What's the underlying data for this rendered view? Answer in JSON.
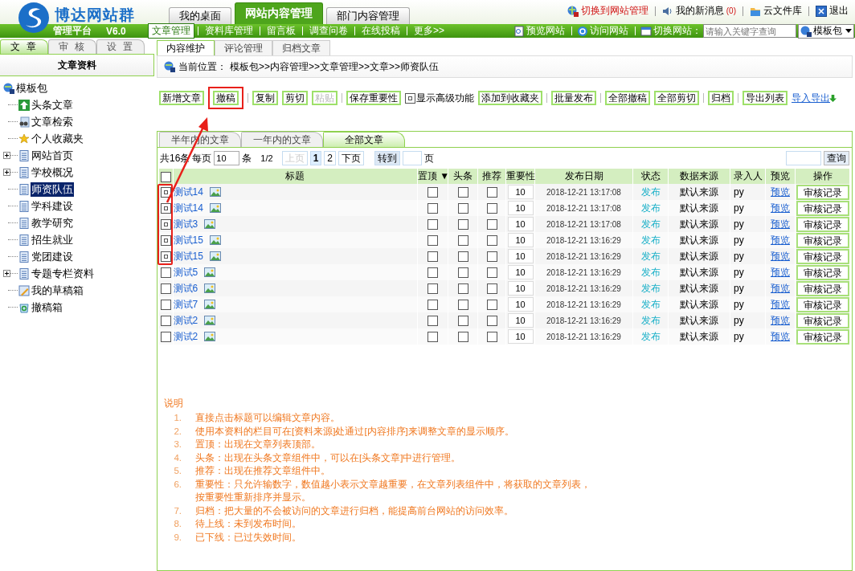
{
  "header": {
    "brand": "博达网站群",
    "subtitle": "管理平台",
    "version": "V6.0",
    "top_tabs": [
      {
        "label": "我的桌面",
        "selected": false
      },
      {
        "label": "网站内容管理",
        "selected": true
      },
      {
        "label": "部门内容管理",
        "selected": false
      }
    ],
    "top_links": [
      {
        "kind": "switch",
        "label": "切换到网站管理"
      },
      {
        "kind": "messages",
        "label": "我的新消息",
        "count": "(0)"
      },
      {
        "kind": "files",
        "label": "云文件库"
      },
      {
        "kind": "exit",
        "label": "退出"
      }
    ]
  },
  "nav": {
    "items": [
      {
        "label": "文章管理",
        "selected": true
      },
      {
        "label": "资料库管理",
        "selected": false
      },
      {
        "label": "留言板",
        "selected": false
      },
      {
        "label": "调查问卷",
        "selected": false
      },
      {
        "label": "在线投稿",
        "selected": false
      },
      {
        "label": "更多>>",
        "selected": false
      }
    ],
    "links": [
      {
        "kind": "preview",
        "label": "预览网站"
      },
      {
        "kind": "visit",
        "label": "访问网站"
      }
    ],
    "switch_label": "切换网站：",
    "search_placeholder": "请输入关键字查询",
    "site": "模板包"
  },
  "sidebar": {
    "tabs": [
      {
        "label": "文 章",
        "selected": true
      },
      {
        "label": "审 核",
        "selected": false
      },
      {
        "label": "设 置",
        "selected": false
      }
    ],
    "title": "文章资料",
    "tree": {
      "label": "模板包",
      "children": [
        {
          "label": "头条文章",
          "kind": "top",
          "expander": false,
          "selected": false
        },
        {
          "label": "文章检索",
          "kind": "search",
          "expander": false,
          "selected": false
        },
        {
          "label": "个人收藏夹",
          "kind": "star",
          "expander": false,
          "selected": false
        },
        {
          "label": "网站首页",
          "kind": "page",
          "expander": true,
          "selected": false
        },
        {
          "label": "学校概况",
          "kind": "page",
          "expander": true,
          "selected": false
        },
        {
          "label": "师资队伍",
          "kind": "page",
          "expander": false,
          "selected": true
        },
        {
          "label": "学科建设",
          "kind": "page",
          "expander": false,
          "selected": false
        },
        {
          "label": "教学研究",
          "kind": "page",
          "expander": false,
          "selected": false
        },
        {
          "label": "招生就业",
          "kind": "page",
          "expander": false,
          "selected": false
        },
        {
          "label": "党团建设",
          "kind": "page",
          "expander": false,
          "selected": false
        },
        {
          "label": "专题专栏资料",
          "kind": "page",
          "expander": true,
          "selected": false
        },
        {
          "label": "我的草稿箱",
          "kind": "drafts",
          "expander": false,
          "selected": false
        },
        {
          "label": "撤稿箱",
          "kind": "recycle",
          "expander": false,
          "selected": false
        }
      ]
    }
  },
  "main": {
    "tabs": [
      {
        "label": "内容维护",
        "selected": true
      },
      {
        "label": "评论管理",
        "selected": false
      },
      {
        "label": "归档文章",
        "selected": false
      }
    ],
    "breadcrumb_label": "当前位置：",
    "breadcrumb": "模板包>>内容管理>>文章管理>>文章>>师资队伍",
    "toolbar": [
      [
        {
          "kind": "button",
          "label": "新增文章",
          "disabled": false,
          "highlighted": false
        },
        {
          "kind": "button",
          "label": "撤稿",
          "disabled": false,
          "highlighted": true
        }
      ],
      [
        {
          "kind": "button",
          "label": "复制",
          "disabled": false,
          "highlighted": false
        },
        {
          "kind": "button",
          "label": "剪切",
          "disabled": false,
          "highlighted": false
        },
        {
          "kind": "button",
          "label": "粘贴",
          "disabled": true,
          "highlighted": false
        }
      ],
      [
        {
          "kind": "button",
          "label": "保存重要性",
          "disabled": false,
          "highlighted": false
        },
        {
          "kind": "checkbox",
          "label": "显示高级功能",
          "checked": true
        },
        {
          "kind": "button",
          "label": "添加到收藏夹",
          "disabled": false,
          "highlighted": false
        }
      ],
      [
        {
          "kind": "button",
          "label": "批量发布",
          "disabled": false,
          "highlighted": false
        }
      ],
      [
        {
          "kind": "button",
          "label": "全部撤稿",
          "disabled": false,
          "highlighted": false
        },
        {
          "kind": "button",
          "label": "全部剪切",
          "disabled": false,
          "highlighted": false
        }
      ],
      [
        {
          "kind": "button",
          "label": "归档",
          "disabled": false,
          "highlighted": false
        }
      ],
      [
        {
          "kind": "button",
          "label": "导出列表",
          "disabled": false,
          "highlighted": false
        },
        {
          "kind": "link",
          "label": "导入导出"
        }
      ]
    ],
    "sub_tabs": [
      {
        "label": "半年内的文章",
        "selected": false
      },
      {
        "label": "一年内的文章",
        "selected": false
      },
      {
        "label": "全部文章",
        "selected": true
      }
    ],
    "pager": {
      "total": "共16条",
      "per_page_label": "每页",
      "per_page": "10",
      "unit": "条",
      "page_of": "1/2",
      "buttons": [
        {
          "label": "上页",
          "disabled": true,
          "selected": false
        },
        {
          "label": "1",
          "disabled": false,
          "selected": true
        },
        {
          "label": "2",
          "disabled": false,
          "selected": false
        },
        {
          "label": "下页",
          "disabled": false,
          "selected": false
        }
      ],
      "goto": "转到",
      "page_unit": "页",
      "search_button": "查询"
    },
    "table": {
      "select_all": false,
      "columns": [
        "标题",
        "置顶 ▼",
        "头条",
        "推荐",
        "重要性",
        "发布日期",
        "状态",
        "数据来源",
        "录入人",
        "预览",
        "操作"
      ],
      "rows": [
        {
          "checked": true,
          "highlighted": true,
          "title": "测试14",
          "top": false,
          "headline": false,
          "recommend": false,
          "importance": "10",
          "date": "2018-12-21 13:17:08",
          "status": "发布",
          "source": "默认来源",
          "author": "py",
          "preview": "预览",
          "action": "审核记录"
        },
        {
          "checked": true,
          "highlighted": true,
          "title": "测试14",
          "top": false,
          "headline": false,
          "recommend": false,
          "importance": "10",
          "date": "2018-12-21 13:17:08",
          "status": "发布",
          "source": "默认来源",
          "author": "py",
          "preview": "预览",
          "action": "审核记录"
        },
        {
          "checked": true,
          "highlighted": true,
          "title": "测试3",
          "top": false,
          "headline": false,
          "recommend": false,
          "importance": "10",
          "date": "2018-12-21 13:17:08",
          "status": "发布",
          "source": "默认来源",
          "author": "py",
          "preview": "预览",
          "action": "审核记录"
        },
        {
          "checked": true,
          "highlighted": true,
          "title": "测试15",
          "top": false,
          "headline": false,
          "recommend": false,
          "importance": "10",
          "date": "2018-12-21 13:16:29",
          "status": "发布",
          "source": "默认来源",
          "author": "py",
          "preview": "预览",
          "action": "审核记录"
        },
        {
          "checked": true,
          "highlighted": true,
          "title": "测试15",
          "top": false,
          "headline": false,
          "recommend": false,
          "importance": "10",
          "date": "2018-12-21 13:16:29",
          "status": "发布",
          "source": "默认来源",
          "author": "py",
          "preview": "预览",
          "action": "审核记录"
        },
        {
          "checked": false,
          "highlighted": false,
          "title": "测试5",
          "top": false,
          "headline": false,
          "recommend": false,
          "importance": "10",
          "date": "2018-12-21 13:16:29",
          "status": "发布",
          "source": "默认来源",
          "author": "py",
          "preview": "预览",
          "action": "审核记录"
        },
        {
          "checked": false,
          "highlighted": false,
          "title": "测试6",
          "top": false,
          "headline": false,
          "recommend": false,
          "importance": "10",
          "date": "2018-12-21 13:16:29",
          "status": "发布",
          "source": "默认来源",
          "author": "py",
          "preview": "预览",
          "action": "审核记录"
        },
        {
          "checked": false,
          "highlighted": false,
          "title": "测试7",
          "top": false,
          "headline": false,
          "recommend": false,
          "importance": "10",
          "date": "2018-12-21 13:16:29",
          "status": "发布",
          "source": "默认来源",
          "author": "py",
          "preview": "预览",
          "action": "审核记录"
        },
        {
          "checked": false,
          "highlighted": false,
          "title": "测试2",
          "top": false,
          "headline": false,
          "recommend": false,
          "importance": "10",
          "date": "2018-12-21 13:16:29",
          "status": "发布",
          "source": "默认来源",
          "author": "py",
          "preview": "预览",
          "action": "审核记录"
        },
        {
          "checked": false,
          "highlighted": false,
          "title": "测试2",
          "top": false,
          "headline": false,
          "recommend": false,
          "importance": "10",
          "date": "2018-12-21 13:16:29",
          "status": "发布",
          "source": "默认来源",
          "author": "py",
          "preview": "预览",
          "action": "审核记录"
        }
      ]
    },
    "notes": {
      "heading": "说明",
      "items": [
        {
          "number": "1.",
          "text": "直接点击标题可以编辑文章内容。"
        },
        {
          "number": "2.",
          "text": "使用本资料的栏目可在[资料来源]处通过[内容排序]来调整文章的显示顺序。"
        },
        {
          "number": "3.",
          "text": "置顶：出现在文章列表顶部。"
        },
        {
          "number": "4.",
          "text": "头条：出现在头条文章组件中，可以在[头条文章]中进行管理。"
        },
        {
          "number": "5.",
          "text": "推荐：出现在推荐文章组件中。"
        },
        {
          "number": "6.",
          "text": "重要性：只允许输数字，数值越小表示文章越重要，在文章列表组件中，将获取的文章列表，按重要性重新排序并显示。"
        },
        {
          "number": "7.",
          "text": "归档：把大量的不会被访问的文章进行归档，能提高前台网站的访问效率。"
        },
        {
          "number": "8.",
          "text": "待上线：未到发布时间。"
        },
        {
          "number": "9.",
          "text": "已下线：已过失效时间。"
        }
      ]
    }
  }
}
